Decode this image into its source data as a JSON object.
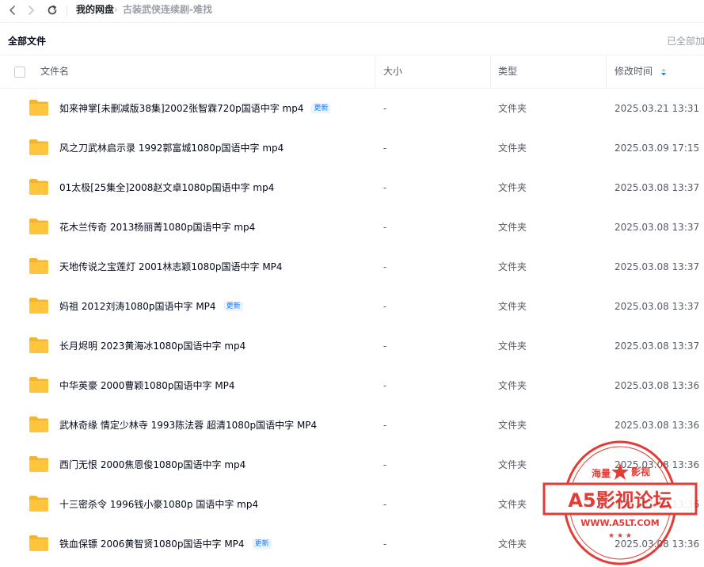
{
  "nav": {
    "breadcrumb_root": "我的网盘",
    "breadcrumb_sep": "›",
    "breadcrumb_current": "古装武侠连续剧-难找"
  },
  "toolbar": {
    "title": "全部文件",
    "loaded_text": "已全部加"
  },
  "table": {
    "columns": {
      "name": "文件名",
      "size": "大小",
      "type": "类型",
      "modified": "修改时间"
    },
    "rows": [
      {
        "name": "如来神掌[未删减版38集]2002张智霖720p国语中字 mp4",
        "badge": "更新",
        "size": "-",
        "type": "文件夹",
        "modified": "2025.03.21 13:31"
      },
      {
        "name": "风之刀武林启示录 1992郭富城1080p国语中字 mp4",
        "badge": "",
        "size": "-",
        "type": "文件夹",
        "modified": "2025.03.09 17:15"
      },
      {
        "name": "01太极[25集全]2008赵文卓1080p国语中字 mp4",
        "badge": "",
        "size": "-",
        "type": "文件夹",
        "modified": "2025.03.08 13:37"
      },
      {
        "name": "花木兰传奇 2013杨丽菁1080p国语中字 mp4",
        "badge": "",
        "size": "-",
        "type": "文件夹",
        "modified": "2025.03.08 13:37"
      },
      {
        "name": "天地传说之宝莲灯 2001林志颖1080p国语中字 MP4",
        "badge": "",
        "size": "-",
        "type": "文件夹",
        "modified": "2025.03.08 13:37"
      },
      {
        "name": "妈祖 2012刘涛1080p国语中字 MP4",
        "badge": "更新",
        "size": "-",
        "type": "文件夹",
        "modified": "2025.03.08 13:37"
      },
      {
        "name": "长月烬明 2023黄海冰1080p国语中字 mp4",
        "badge": "",
        "size": "-",
        "type": "文件夹",
        "modified": "2025.03.08 13:37"
      },
      {
        "name": "中华英豪 2000曹颖1080p国语中字 MP4",
        "badge": "",
        "size": "-",
        "type": "文件夹",
        "modified": "2025.03.08 13:36"
      },
      {
        "name": "武林奇缘 情定少林寺 1993陈法蓉 超清1080p国语中字 MP4",
        "badge": "",
        "size": "-",
        "type": "文件夹",
        "modified": "2025.03.08 13:36"
      },
      {
        "name": "西门无恨 2000焦恩俊1080p国语中字 mp4",
        "badge": "",
        "size": "-",
        "type": "文件夹",
        "modified": "2025.03.08 13:36"
      },
      {
        "name": "十三密杀令 1996钱小豪1080p 国语中字 mp4",
        "badge": "",
        "size": "-",
        "type": "文件夹",
        "modified": "2025.03.08 13:36"
      },
      {
        "name": "铁血保镖 2006黄智贤1080p国语中字 MP4",
        "badge": "更新",
        "size": "-",
        "type": "文件夹",
        "modified": "2025.03.08 13:36"
      }
    ]
  },
  "watermark": {
    "top_left": "海量",
    "top_right": "影视",
    "main": "A5影视论坛",
    "url": "WWW.A5LT.COM"
  },
  "colors": {
    "folder": "#ffc53d",
    "badge_bg": "#e8f4ff",
    "badge_text": "#1a7dff",
    "stamp": "#e0221b"
  },
  "icons": {
    "back": "chevron-left-icon",
    "forward": "chevron-right-icon",
    "refresh": "refresh-icon",
    "sort": "sort-icon",
    "folder": "folder-icon"
  }
}
